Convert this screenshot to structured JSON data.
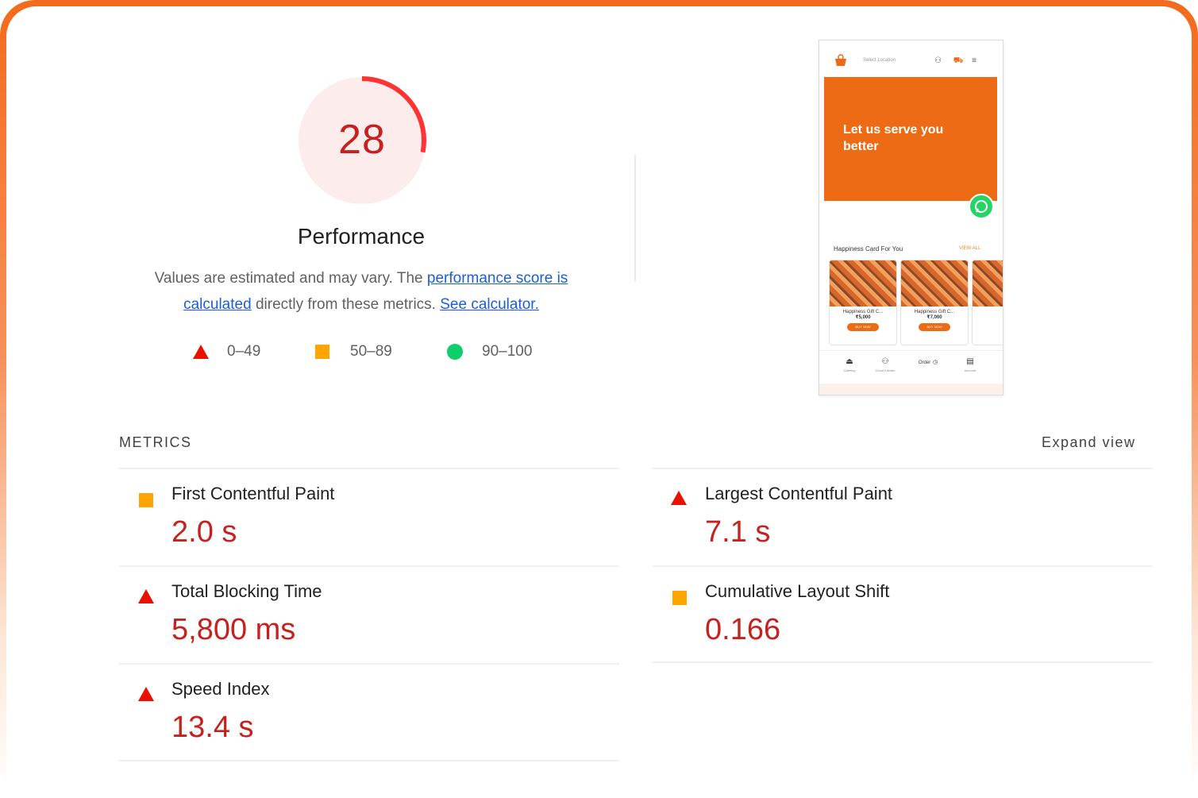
{
  "performance": {
    "score": "28",
    "score_fraction": 0.28,
    "title": "Performance",
    "description_1": "Values are estimated and may vary. The ",
    "description_link_1": "performance score is calculated",
    "description_2": " directly from these metrics. ",
    "description_link_2": "See calculator."
  },
  "legend": [
    {
      "icon": "red-triangle",
      "label": "0–49"
    },
    {
      "icon": "orange-square",
      "label": "50–89"
    },
    {
      "icon": "green-circle",
      "label": "90–100"
    }
  ],
  "screenshot": {
    "location_placeholder": "Select Location",
    "banner_text": "Let us serve you better",
    "section_title": "Happiness Card For You",
    "view_all": "VIEW ALL",
    "cards": [
      {
        "name": "Happiness Gift C...",
        "price": "₹5,000",
        "button": "BUY NOW"
      },
      {
        "name": "Happiness Gift C...",
        "price": "₹7,000",
        "button": "BUY NOW"
      }
    ],
    "nav": [
      "Catering",
      "Cloud Kitchen",
      "Order",
      "Account"
    ]
  },
  "metrics": {
    "header": "METRICS",
    "expand": "Expand view",
    "items": [
      {
        "name": "First Contentful Paint",
        "value": "2.0 s",
        "status": "average"
      },
      {
        "name": "Largest Contentful Paint",
        "value": "7.1 s",
        "status": "fail"
      },
      {
        "name": "Total Blocking Time",
        "value": "5,800 ms",
        "status": "fail"
      },
      {
        "name": "Cumulative Layout Shift",
        "value": "0.166",
        "status": "average"
      },
      {
        "name": "Speed Index",
        "value": "13.4 s",
        "status": "fail"
      }
    ]
  },
  "colors": {
    "fail": "#eb0f00",
    "average": "#ffa400",
    "pass": "#0cce6b",
    "score_text": "#c5221f",
    "frame_accent": "#f36b1c"
  }
}
